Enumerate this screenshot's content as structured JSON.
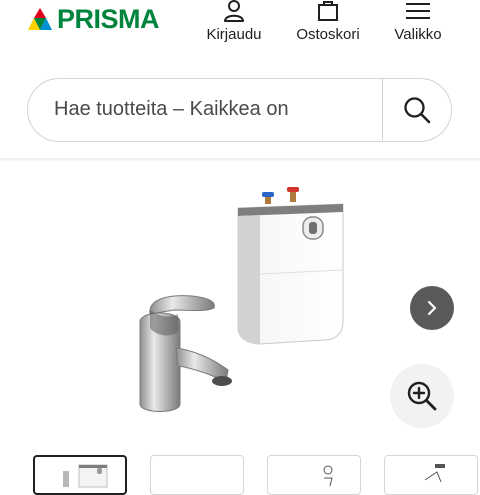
{
  "header": {
    "logo": {
      "text": "PRISMA",
      "colors": [
        "#e2001a",
        "#ffd100",
        "#00843d",
        "#0091d5"
      ]
    },
    "nav": [
      {
        "id": "login",
        "label": "Kirjaudu",
        "icon": "user-icon"
      },
      {
        "id": "cart",
        "label": "Ostoskori",
        "icon": "shopping-bag-icon"
      },
      {
        "id": "menu",
        "label": "Valikko",
        "icon": "hamburger-menu-icon"
      }
    ]
  },
  "search": {
    "placeholder": "Hae tuotteita – Kaikkea on",
    "value": "",
    "button_icon": "search-icon"
  },
  "gallery": {
    "main_image": "faucet-and-water-heater-product-image",
    "next_icon": "chevron-right-icon",
    "zoom_icon": "zoom-in-icon",
    "thumbnails": [
      {
        "id": "thumb-1",
        "active": true
      },
      {
        "id": "thumb-2",
        "active": false
      },
      {
        "id": "thumb-3",
        "active": false
      },
      {
        "id": "thumb-4",
        "active": false
      }
    ]
  },
  "colors": {
    "brand_green": "#00843d",
    "next_button_bg": "#5a5a5a",
    "zoom_button_bg": "#f2f2f2"
  }
}
